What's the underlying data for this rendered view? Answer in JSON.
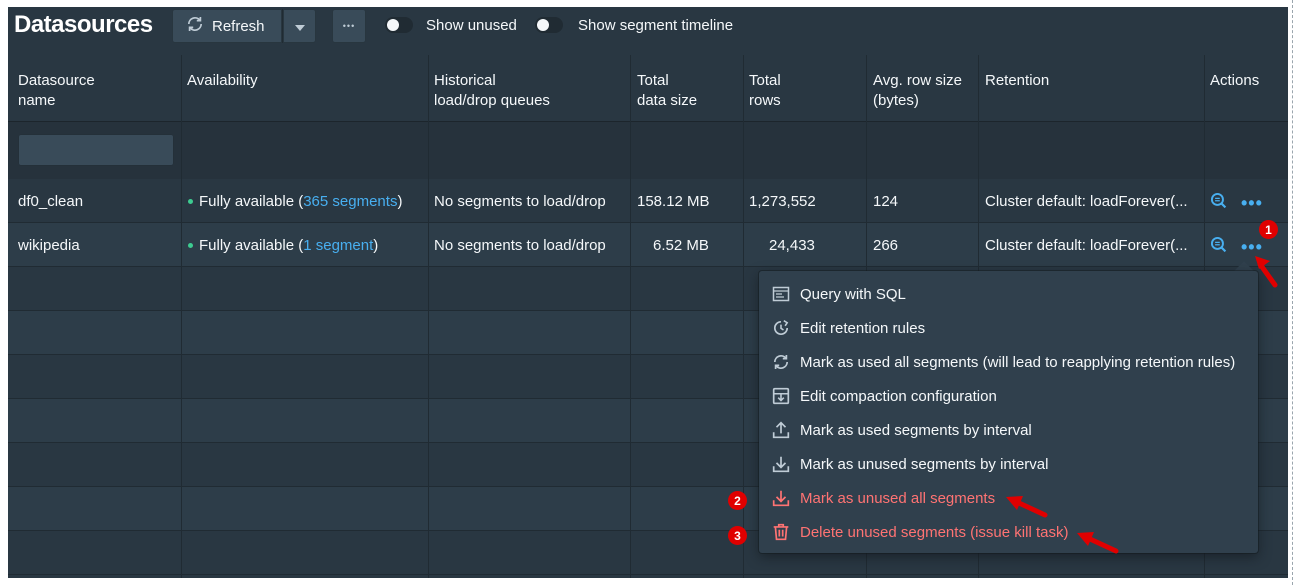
{
  "header": {
    "title": "Datasources",
    "refresh_label": "Refresh",
    "more_label": "•••",
    "toggles": [
      {
        "label": "Show unused",
        "checked": false
      },
      {
        "label": "Show segment timeline",
        "checked": false
      }
    ]
  },
  "table": {
    "columns": [
      {
        "line1": "Datasource",
        "line2": "name"
      },
      {
        "line1": "Availability",
        "line2": ""
      },
      {
        "line1": "Historical",
        "line2": "load/drop queues"
      },
      {
        "line1": "Total",
        "line2": "data size"
      },
      {
        "line1": "Total",
        "line2": "rows"
      },
      {
        "line1": "Avg. row size",
        "line2": "(bytes)"
      },
      {
        "line1": "Retention",
        "line2": ""
      },
      {
        "line1": "Actions",
        "line2": ""
      }
    ],
    "filter_value": "",
    "rows": [
      {
        "name": "df0_clean",
        "availability_prefix": "Fully available (",
        "availability_link": "365 segments",
        "availability_suffix": ")",
        "queues": "No segments to load/drop",
        "size": "158.12 MB",
        "rows": "1,273,552",
        "avg_row": "124",
        "retention": "Cluster default: loadForever(..."
      },
      {
        "name": "wikipedia",
        "availability_prefix": "Fully available (",
        "availability_link": "1 segment",
        "availability_suffix": ")",
        "queues": "No segments to load/drop",
        "size": "6.52 MB",
        "rows": "24,433",
        "avg_row": "266",
        "retention": "Cluster default: loadForever(..."
      }
    ]
  },
  "menu": {
    "items": [
      {
        "label": "Query with SQL",
        "icon": "application-icon",
        "danger": false
      },
      {
        "label": "Edit retention rules",
        "icon": "automatic-updates-icon",
        "danger": false
      },
      {
        "label": "Mark as used all segments (will lead to reapplying retention rules)",
        "icon": "refresh-icon",
        "danger": false
      },
      {
        "label": "Edit compaction configuration",
        "icon": "compressed-icon",
        "danger": false
      },
      {
        "label": "Mark as used segments by interval",
        "icon": "upload-icon",
        "danger": false
      },
      {
        "label": "Mark as unused segments by interval",
        "icon": "download-icon",
        "danger": false
      },
      {
        "label": "Mark as unused all segments",
        "icon": "download-icon",
        "danger": true
      },
      {
        "label": "Delete unused segments (issue kill task)",
        "icon": "trash-icon",
        "danger": true
      }
    ]
  },
  "annotations": {
    "badges": [
      "1",
      "2",
      "3"
    ],
    "color": "#e00000"
  },
  "colors": {
    "background": "#293742",
    "accent_link": "#48aff0",
    "status_ok": "#3dcc91",
    "danger": "#ff7373"
  }
}
